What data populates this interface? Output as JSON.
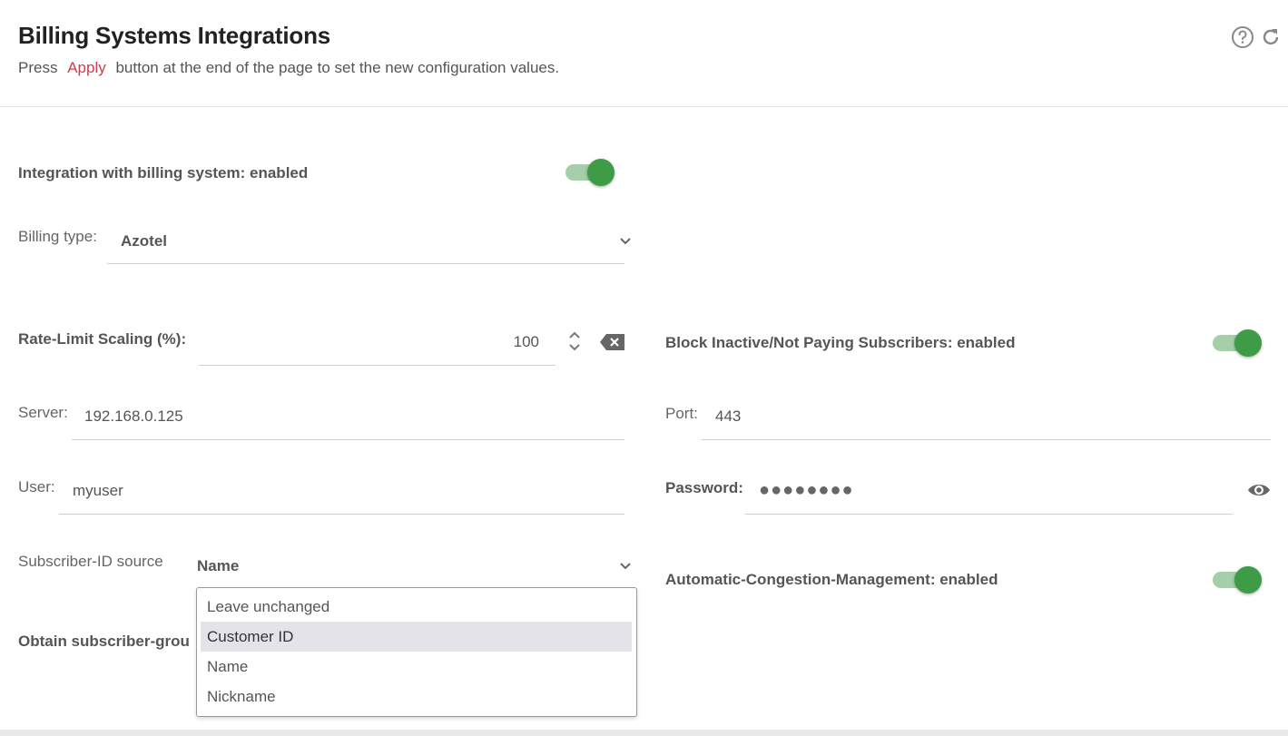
{
  "header": {
    "title": "Billing Systems Integrations",
    "subtitle_prefix": "Press",
    "subtitle_link": "Apply",
    "subtitle_suffix": "button at the end of the page to set the new configuration values."
  },
  "icons": {
    "help": "help-circle-icon",
    "refresh": "refresh-icon",
    "chevron": "chevron-down-icon",
    "stepper": "stepper-icon",
    "clear": "backspace-icon",
    "eye": "eye-icon"
  },
  "form": {
    "integration": {
      "label": "Integration with billing system: enabled",
      "enabled": true
    },
    "billing_type": {
      "label": "Billing type:",
      "value": "Azotel"
    },
    "rate_limit": {
      "label": "Rate-Limit Scaling (%):",
      "value": "100"
    },
    "block_inactive": {
      "label": "Block Inactive/Not Paying Subscribers: enabled",
      "enabled": true
    },
    "server": {
      "label": "Server:",
      "value": "192.168.0.125"
    },
    "port": {
      "label": "Port:",
      "value": "443"
    },
    "user": {
      "label": "User:",
      "value": "myuser"
    },
    "password": {
      "label": "Password:",
      "value": "●●●●●●●●"
    },
    "subscriber_id_source": {
      "label": "Subscriber-ID source",
      "value": "Name",
      "options": [
        "Leave unchanged",
        "Customer ID",
        "Name",
        "Nickname"
      ],
      "highlighted": "Customer ID"
    },
    "congestion": {
      "label": "Automatic-Congestion-Management: enabled",
      "enabled": true
    },
    "obtain_group": {
      "label": "Obtain subscriber-grou"
    }
  },
  "colors": {
    "accent_link": "#d23a4c",
    "toggle_on": "#3e9c47",
    "toggle_track": "#a5cfa8"
  }
}
